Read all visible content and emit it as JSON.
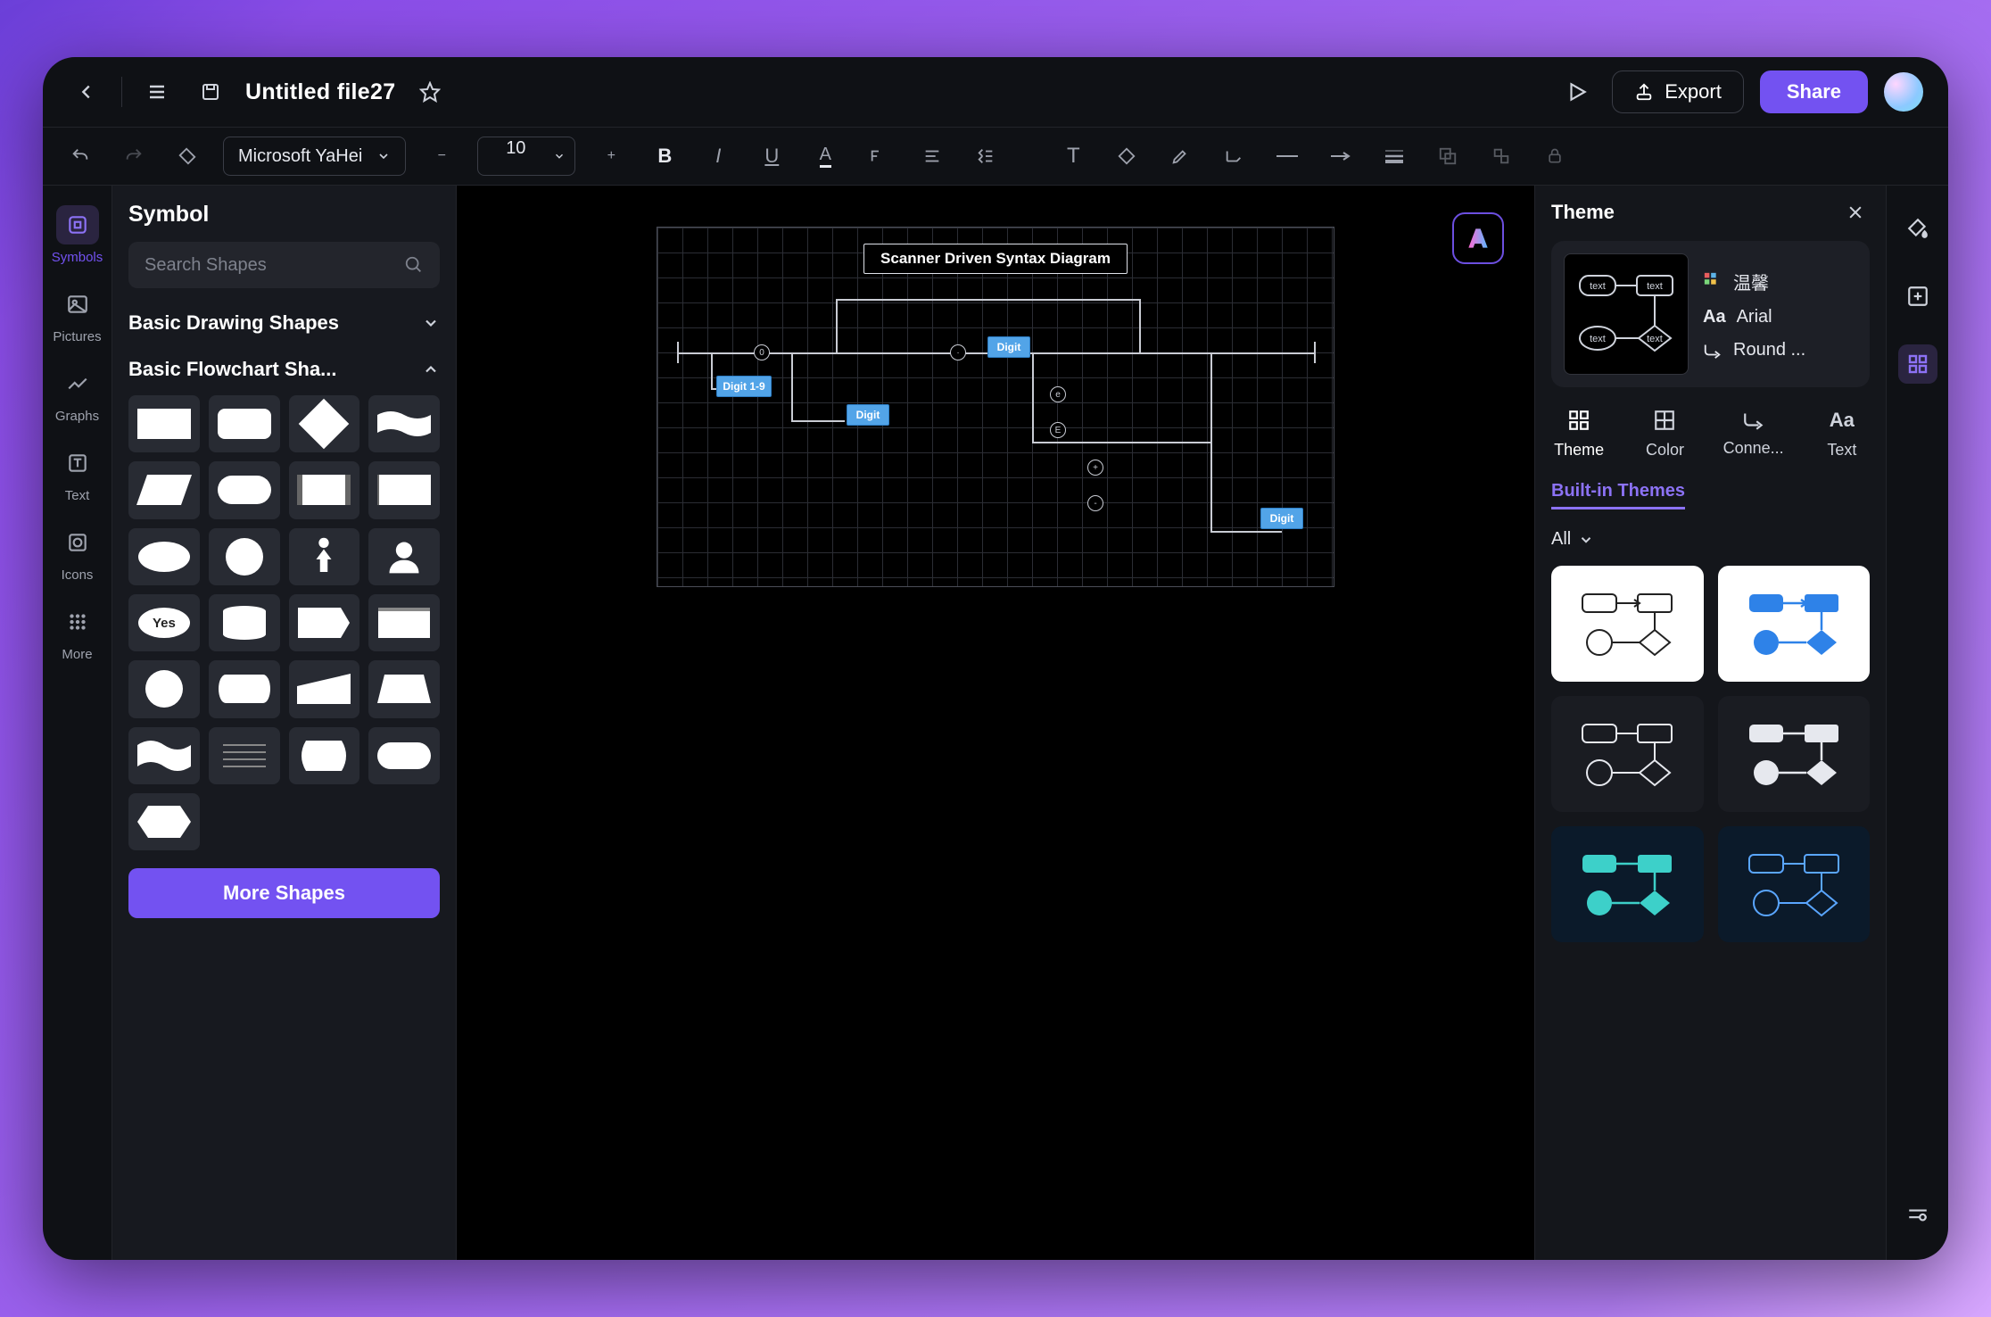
{
  "header": {
    "file_title": "Untitled file27",
    "export_label": "Export",
    "share_label": "Share"
  },
  "format": {
    "font_family": "Microsoft YaHei",
    "font_size": "10"
  },
  "rail": {
    "items": [
      {
        "label": "Symbols"
      },
      {
        "label": "Pictures"
      },
      {
        "label": "Graphs"
      },
      {
        "label": "Text"
      },
      {
        "label": "Icons"
      },
      {
        "label": "More"
      }
    ]
  },
  "sidepanel": {
    "title": "Symbol",
    "search_placeholder": "Search Shapes",
    "cat_basic": "Basic Drawing Shapes",
    "cat_flow": "Basic Flowchart Sha...",
    "yes_label": "Yes",
    "more_shapes": "More Shapes"
  },
  "diagram": {
    "title": "Scanner Driven Syntax Diagram",
    "nodes": {
      "n1": "Digit 1-9",
      "n2": "Digit",
      "n3": "Digit",
      "n4": "Digit"
    },
    "circles": {
      "c1": "0",
      "c2": "-",
      "c3": "·",
      "c4": "e",
      "c5": "E",
      "c6": "+",
      "c7": "-"
    }
  },
  "theme": {
    "title": "Theme",
    "name": "温馨",
    "font": "Arial",
    "connector": "Round ...",
    "tabs": {
      "theme": "Theme",
      "color": "Color",
      "connector": "Conne...",
      "text": "Text"
    },
    "link_built": "Built-in Themes",
    "filter_all": "All"
  }
}
